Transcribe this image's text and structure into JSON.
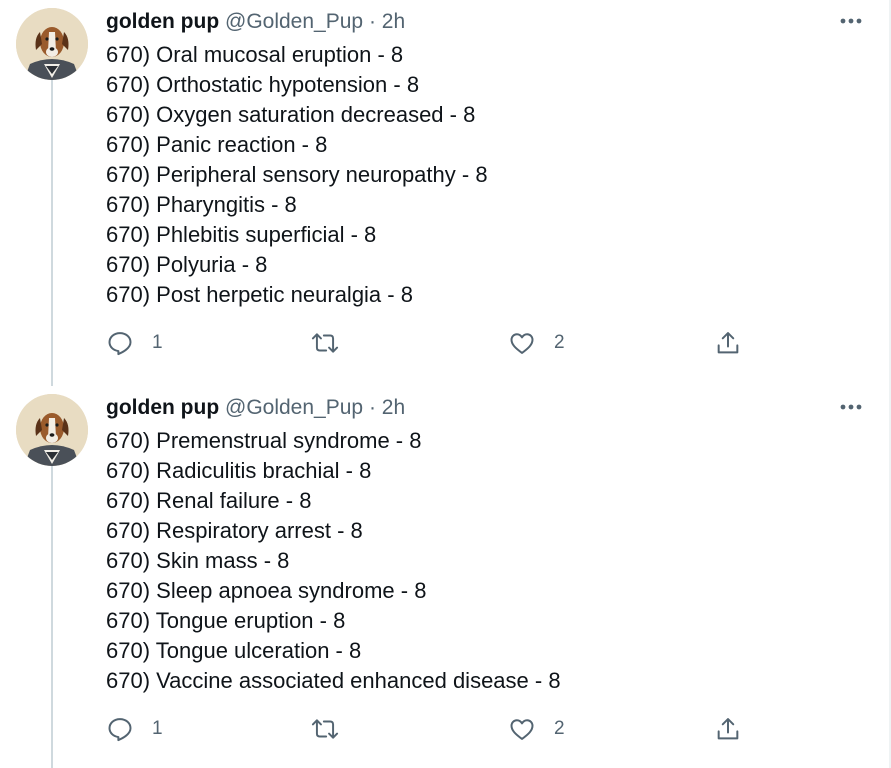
{
  "tweets": [
    {
      "author": {
        "name": "golden pup",
        "handle": "@Golden_Pup",
        "separator": "·",
        "time": "2h",
        "avatar_icon": "dog-portrait-avatar"
      },
      "lines": [
        "670) Oral mucosal eruption - 8",
        "670) Orthostatic hypotension - 8",
        "670) Oxygen saturation decreased - 8",
        "670) Panic reaction - 8",
        "670) Peripheral sensory neuropathy - 8",
        "670) Pharyngitis - 8",
        "670) Phlebitis superficial - 8",
        "670) Polyuria - 8",
        "670) Post herpetic neuralgia - 8"
      ],
      "actions": {
        "reply_count": "1",
        "retweet_count": "",
        "like_count": "2"
      }
    },
    {
      "author": {
        "name": "golden pup",
        "handle": "@Golden_Pup",
        "separator": "·",
        "time": "2h",
        "avatar_icon": "dog-portrait-avatar"
      },
      "lines": [
        "670) Premenstrual syndrome - 8",
        "670) Radiculitis brachial - 8",
        "670) Renal failure - 8",
        "670) Respiratory arrest - 8",
        "670) Skin mass - 8",
        "670) Sleep apnoea syndrome - 8",
        "670) Tongue eruption - 8",
        "670) Tongue ulceration - 8",
        "670) Vaccine associated enhanced disease - 8"
      ],
      "actions": {
        "reply_count": "1",
        "retweet_count": "",
        "like_count": "2"
      }
    }
  ],
  "icons": {
    "reply": "reply-icon",
    "retweet": "retweet-icon",
    "like": "heart-icon",
    "share": "share-icon",
    "more": "more-icon"
  },
  "colors": {
    "text": "#0f1419",
    "secondary": "#536471",
    "thread_line": "#cfd9de"
  }
}
